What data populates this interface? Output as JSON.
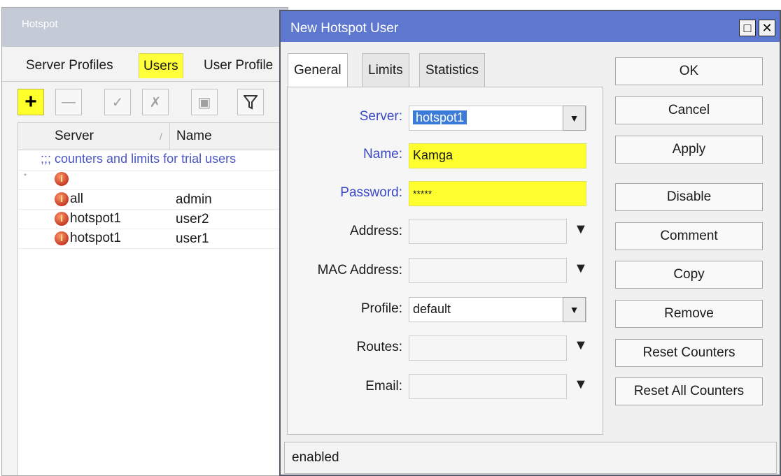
{
  "hotspot_window": {
    "title": "Hotspot",
    "tabs": [
      "Server Profiles",
      "Users",
      "User Profile"
    ],
    "active_tab": "Users",
    "toolbar": [
      "add-icon",
      "remove-icon",
      "enable-icon",
      "disable-icon",
      "comment-icon",
      "filter-icon"
    ],
    "table": {
      "columns": [
        "Server",
        "Name"
      ],
      "comment_row": ";;; counters and limits for trial users",
      "rows": [
        {
          "marker": "*",
          "server": "",
          "name": ""
        },
        {
          "marker": "",
          "server": "all",
          "name": "admin"
        },
        {
          "marker": "",
          "server": "hotspot1",
          "name": "user2"
        },
        {
          "marker": "",
          "server": "hotspot1",
          "name": "user1"
        }
      ]
    }
  },
  "dialog": {
    "title": "New Hotspot User",
    "tabs": [
      "General",
      "Limits",
      "Statistics"
    ],
    "active_tab": "General",
    "fields": {
      "server": {
        "label": "Server:",
        "value": "hotspot1"
      },
      "name": {
        "label": "Name:",
        "value": "Kamga"
      },
      "password": {
        "label": "Password:",
        "value": "*****"
      },
      "address": {
        "label": "Address:",
        "value": ""
      },
      "mac_address": {
        "label": "MAC Address:",
        "value": ""
      },
      "profile": {
        "label": "Profile:",
        "value": "default"
      },
      "routes": {
        "label": "Routes:",
        "value": ""
      },
      "email": {
        "label": "Email:",
        "value": ""
      }
    },
    "buttons": {
      "ok": "OK",
      "cancel": "Cancel",
      "apply": "Apply",
      "disable": "Disable",
      "comment": "Comment",
      "copy": "Copy",
      "remove": "Remove",
      "reset_counters": "Reset Counters",
      "reset_all_counters": "Reset All Counters"
    },
    "status": "enabled"
  },
  "colors": {
    "highlight": "#ffff30",
    "dialog_title": "#5e78cf",
    "label_blue": "#3b48c4",
    "selection": "#3c7bd9"
  }
}
